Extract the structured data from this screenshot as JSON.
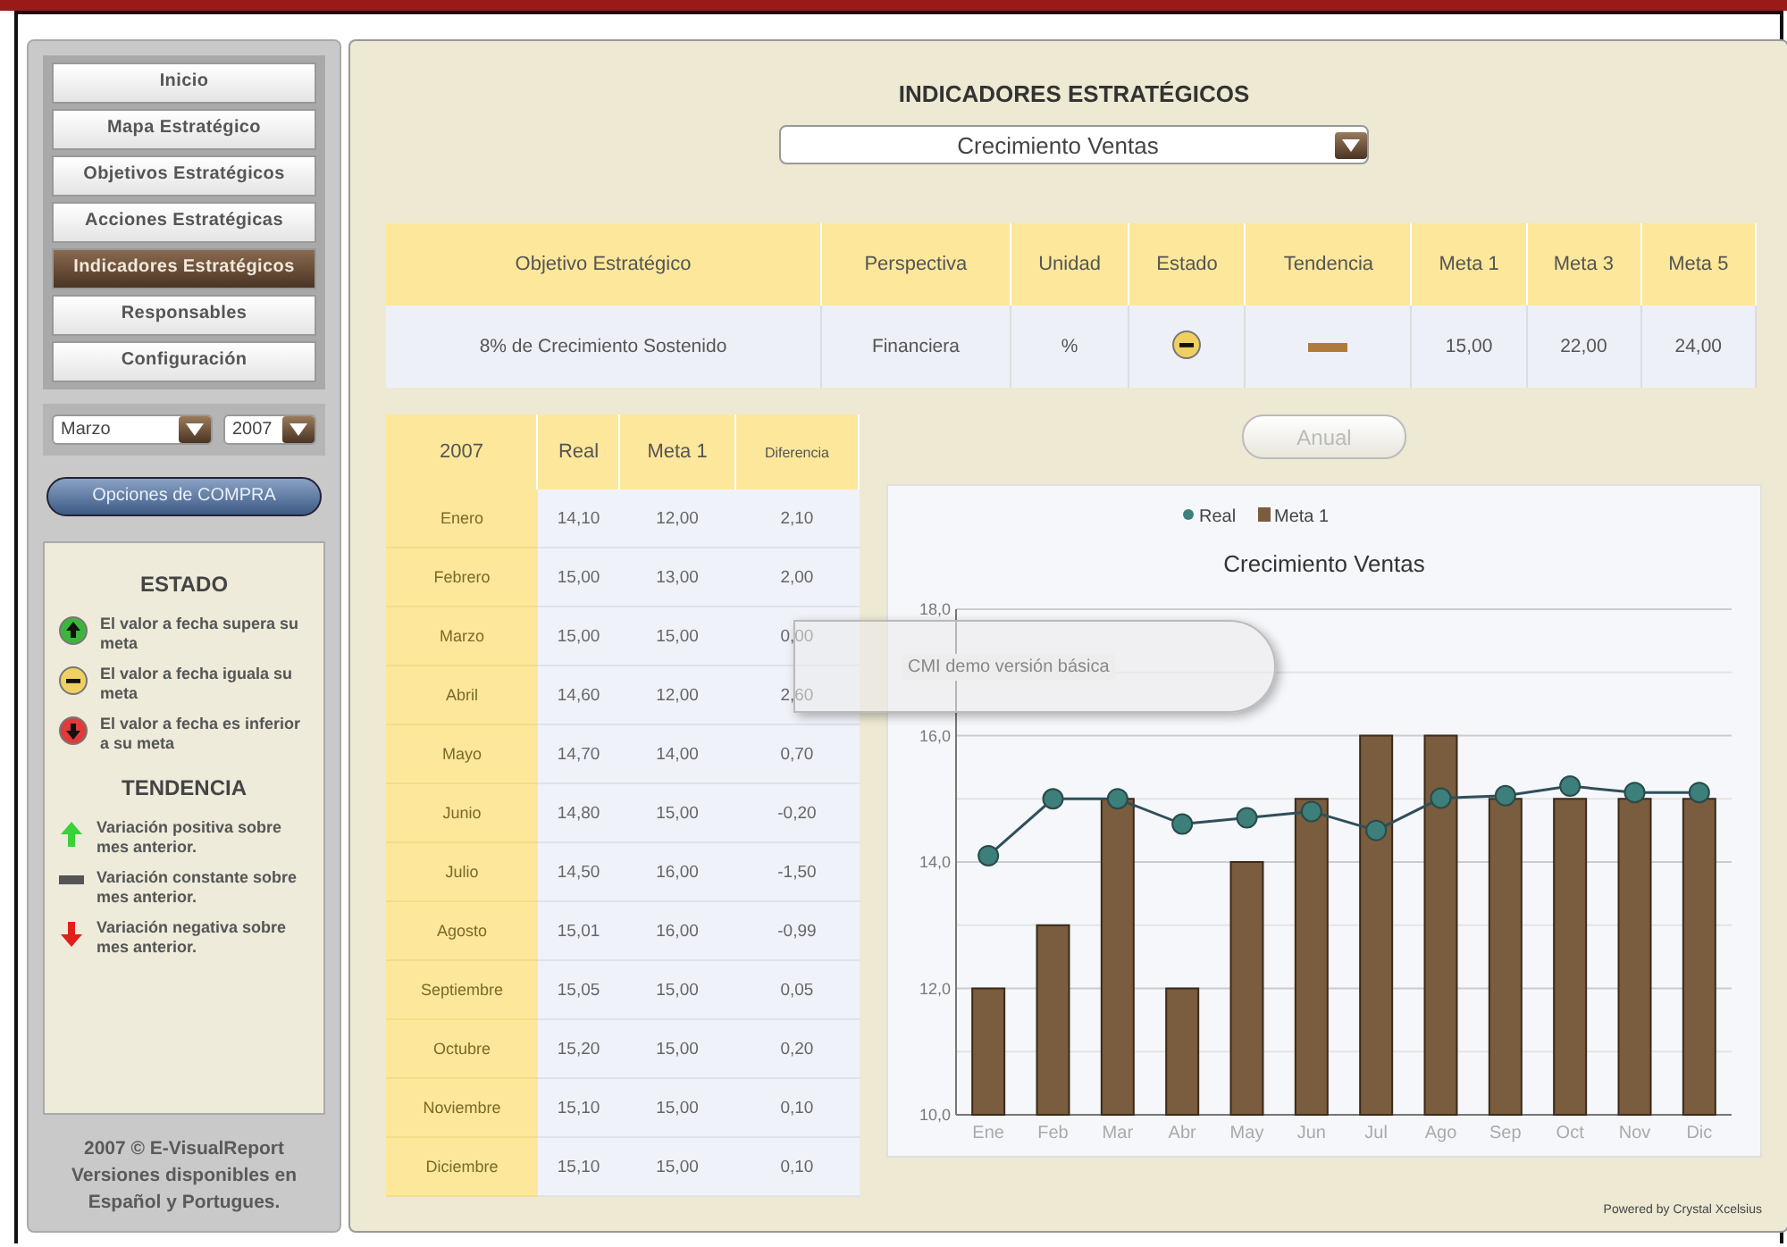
{
  "sidebar": {
    "nav": [
      {
        "label": "Inicio",
        "selected": false
      },
      {
        "label": "Mapa Estratégico",
        "selected": false
      },
      {
        "label": "Objetivos Estratégicos",
        "selected": false
      },
      {
        "label": "Acciones Estratégicas",
        "selected": false
      },
      {
        "label": "Indicadores Estratégicos",
        "selected": true
      },
      {
        "label": "Responsables",
        "selected": false
      },
      {
        "label": "Configuración",
        "selected": false
      }
    ],
    "month_select": {
      "value": "Marzo"
    },
    "year_select": {
      "value": "2007"
    },
    "buy_button": {
      "label": "Opciones de COMPRA"
    },
    "legends": [
      {
        "title": "ESTADO",
        "items": [
          {
            "kind": "above",
            "text": "El valor a fecha supera su meta"
          },
          {
            "kind": "equal",
            "text": "El valor a fecha iguala su meta"
          },
          {
            "kind": "below",
            "text": "El valor a fecha es inferior a su meta"
          }
        ]
      },
      {
        "title": "TENDENCIA",
        "items": [
          {
            "kind": "up",
            "text": "Variación positiva sobre mes anterior."
          },
          {
            "kind": "flat",
            "text": "Variación constante sobre mes anterior."
          },
          {
            "kind": "down",
            "text": "Variación negativa sobre mes anterior."
          }
        ]
      }
    ],
    "footer_lines": [
      "2007 © E-VisualReport",
      "Versiones disponibles en",
      "Español y Portugues."
    ]
  },
  "main": {
    "title": "INDICADORES ESTRATÉGICOS",
    "indicator_select": {
      "value": "Crecimiento Ventas"
    },
    "summary_table": {
      "columns": [
        "Objetivo Estratégico",
        "Perspectiva",
        "Unidad",
        "Estado",
        "Tendencia",
        "Meta 1",
        "Meta 3",
        "Meta 5"
      ],
      "rows": [
        {
          "objetivo": "8% de Crecimiento Sostenido",
          "perspectiva": "Financiera",
          "unidad": "%",
          "estado": {
            "kind": "equal"
          },
          "tendencia": {
            "kind": "flat"
          },
          "meta_1": "15,00",
          "meta_3": "22,00",
          "meta_5": "24,00"
        }
      ]
    },
    "monthly_table": {
      "columns": [
        "2007",
        "Real",
        "Meta 1",
        "Diferencia"
      ],
      "rows": [
        {
          "month": "Enero",
          "real": "14,10",
          "meta_1": "12,00",
          "diferencia": "2,10"
        },
        {
          "month": "Febrero",
          "real": "15,00",
          "meta_1": "13,00",
          "diferencia": "2,00"
        },
        {
          "month": "Marzo",
          "real": "15,00",
          "meta_1": "15,00",
          "diferencia": "0,00"
        },
        {
          "month": "Abril",
          "real": "14,60",
          "meta_1": "12,00",
          "diferencia": "2,60"
        },
        {
          "month": "Mayo",
          "real": "14,70",
          "meta_1": "14,00",
          "diferencia": "0,70"
        },
        {
          "month": "Junio",
          "real": "14,80",
          "meta_1": "15,00",
          "diferencia": "-0,20"
        },
        {
          "month": "Julio",
          "real": "14,50",
          "meta_1": "16,00",
          "diferencia": "-1,50"
        },
        {
          "month": "Agosto",
          "real": "15,01",
          "meta_1": "16,00",
          "diferencia": "-0,99"
        },
        {
          "month": "Septiembre",
          "real": "15,05",
          "meta_1": "15,00",
          "diferencia": "0,05"
        },
        {
          "month": "Octubre",
          "real": "15,20",
          "meta_1": "15,00",
          "diferencia": "0,20"
        },
        {
          "month": "Noviembre",
          "real": "15,10",
          "meta_1": "15,00",
          "diferencia": "0,10"
        },
        {
          "month": "Diciembre",
          "real": "15,10",
          "meta_1": "15,00",
          "diferencia": "0,10"
        }
      ]
    },
    "period_button": {
      "label": "Anual",
      "disabled": true
    },
    "chart": {
      "chart_data": {
        "type": "bar",
        "title": "Crecimiento Ventas",
        "categories": [
          "Ene",
          "Feb",
          "Mar",
          "Abr",
          "May",
          "Jun",
          "Jul",
          "Ago",
          "Sep",
          "Oct",
          "Nov",
          "Dic"
        ],
        "series": [
          {
            "name": "Real",
            "type": "line",
            "marker": "circle",
            "color": "#3d7f7a",
            "values": [
              14.1,
              15.0,
              15.0,
              14.6,
              14.7,
              14.8,
              14.5,
              15.01,
              15.05,
              15.2,
              15.1,
              15.1
            ]
          },
          {
            "name": "Meta 1",
            "type": "bar",
            "color": "#7a5c3e",
            "values": [
              12,
              13,
              15,
              12,
              14,
              15,
              16,
              16,
              15,
              15,
              15,
              15
            ]
          }
        ],
        "stacked": false,
        "grid": true,
        "legend": true,
        "ylim": [
          10,
          18
        ],
        "yticks": [
          {
            "value": 10,
            "label": "10,0"
          },
          {
            "value": 12,
            "label": "12,0"
          },
          {
            "value": 14,
            "label": "14,0"
          },
          {
            "value": 16,
            "label": "16,0"
          },
          {
            "value": 18,
            "label": "18,0"
          }
        ]
      }
    },
    "demo_overlay": {
      "text": "CMI demo versión básica"
    },
    "powered_by": "Powered by Crystal Xcelsius"
  }
}
